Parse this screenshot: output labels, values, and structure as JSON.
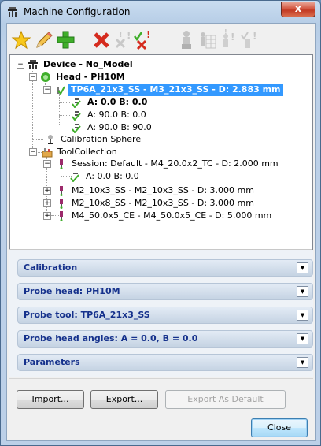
{
  "window": {
    "title": "Machine Configuration",
    "close_glyph": "x"
  },
  "toolbar": {
    "buttons": [
      {
        "name": "star-icon",
        "enabled": true
      },
      {
        "name": "pencil-icon",
        "enabled": true
      },
      {
        "name": "add-icon",
        "enabled": true
      },
      {
        "name": "delete-icon",
        "enabled": true
      },
      {
        "name": "delete-disabled-icon",
        "enabled": false
      },
      {
        "name": "validate-delete-icon",
        "enabled": true
      },
      {
        "name": "probe-icon",
        "enabled": false
      },
      {
        "name": "probe-table-icon",
        "enabled": false
      },
      {
        "name": "probe-warning-icon",
        "enabled": false
      },
      {
        "name": "probe-check-icon",
        "enabled": false
      }
    ]
  },
  "tree": {
    "device": "Device - No_Model",
    "head": "Head - PH10M",
    "selected_tool": "TP6A_21x3_SS - M3_21x3_SS - D:  2.883 mm",
    "angles": [
      "A:  0.0 B:  0.0",
      "A: 90.0 B:  0.0",
      "A: 90.0 B: 90.0"
    ],
    "calibration_sphere": "Calibration Sphere",
    "tool_collection": "ToolCollection",
    "session": "Session: Default - M4_20.0x2_TC - D:  2.000 mm",
    "session_angle": "A:  0.0 B:  0.0",
    "tools": [
      "M2_10x3_SS - M2_10x3_SS - D:  3.000 mm",
      "M2_10x8_SS - M2_10x3_SS - D:  3.000 mm",
      "M4_50.0x5_CE - M4_50.0x5_CE - D:  5.000 mm"
    ]
  },
  "groups": {
    "calibration": "Calibration",
    "probe_head": "Probe head: PH10M",
    "probe_tool": "Probe tool: TP6A_21x3_SS",
    "probe_head_angles": "Probe head angles: A = 0.0, B = 0.0",
    "parameters": "Parameters",
    "expand_glyph": "▼"
  },
  "buttons": {
    "import": "Import...",
    "export": "Export...",
    "export_default": "Export As Default",
    "close": "Close"
  },
  "colors": {
    "selection": "#3399ff",
    "group_text": "#15318c",
    "add": "#3fae2a",
    "delete": "#d52b1e"
  }
}
